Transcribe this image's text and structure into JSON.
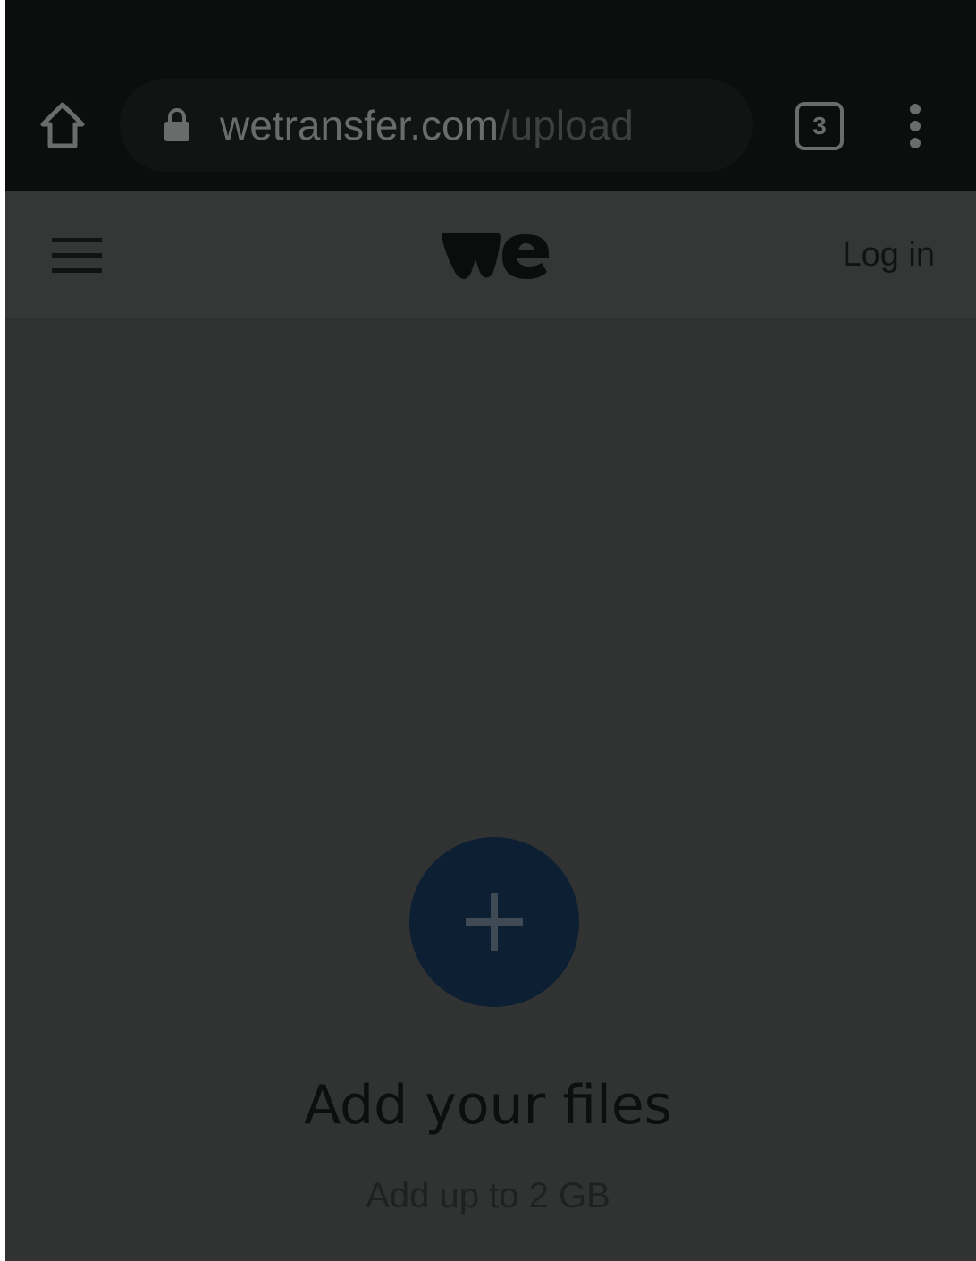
{
  "browser": {
    "url_domain": "wetransfer.com",
    "url_path": "/upload",
    "tab_count": "3",
    "icons": {
      "home": "home-icon",
      "lock": "lock-icon",
      "tabs": "tabs-count-icon",
      "menu": "more-vertical-icon"
    }
  },
  "header": {
    "logo_alt": "we",
    "login_label": "Log in",
    "icons": {
      "menu": "hamburger-menu-icon"
    }
  },
  "upload": {
    "title": "Add your files",
    "subtitle": "Add up to 2 GB",
    "add_icon": "plus-icon"
  },
  "colors": {
    "browser_bar": "#0c0d0d",
    "page_overlay": "#313333",
    "header_bg": "#353737",
    "add_button": "#0d1f33"
  }
}
